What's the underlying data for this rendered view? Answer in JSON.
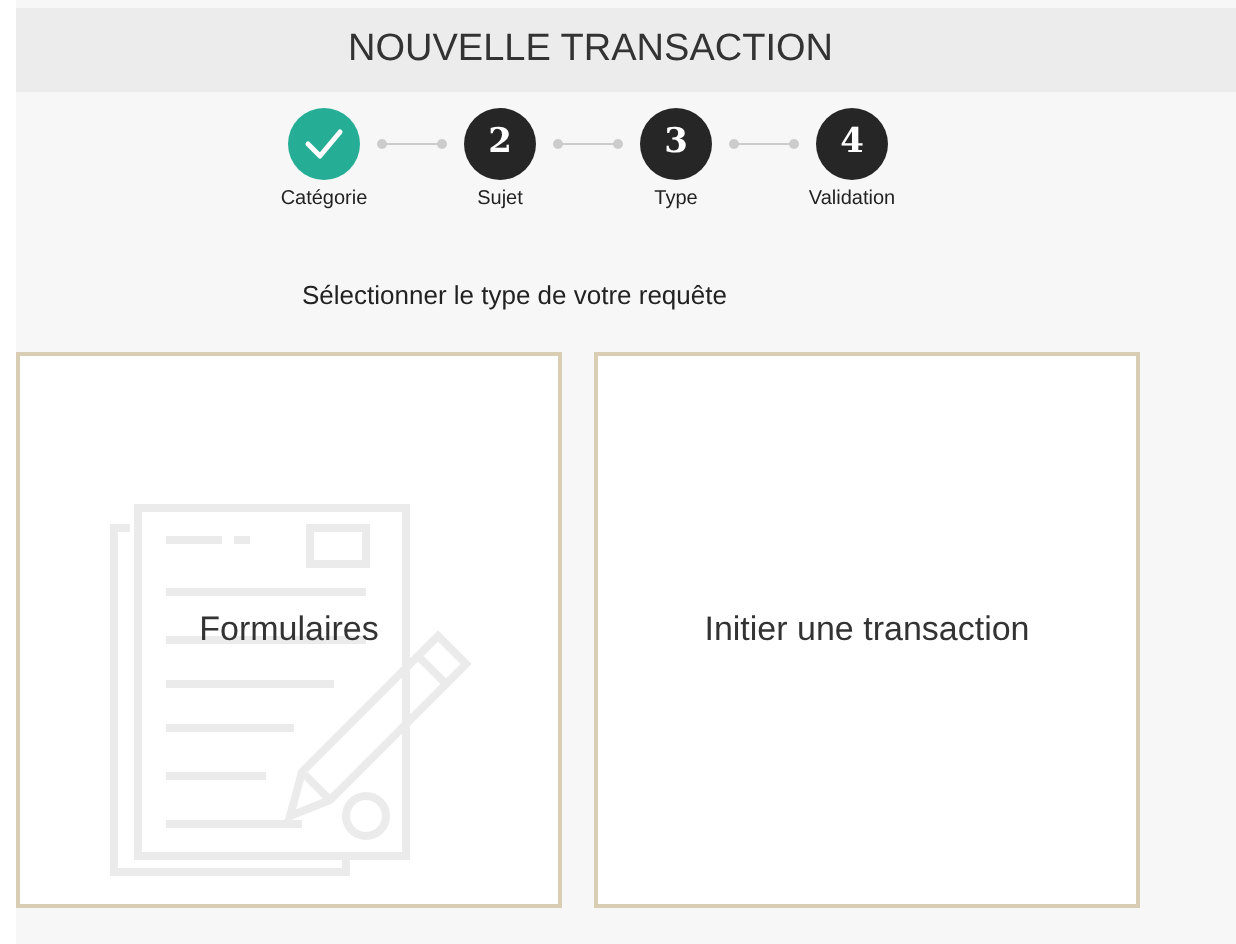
{
  "title": "NOUVELLE TRANSACTION",
  "steps": [
    {
      "label": "Catégorie",
      "done": true
    },
    {
      "label": "Sujet",
      "number": "2",
      "done": false
    },
    {
      "label": "Type",
      "number": "3",
      "done": false
    },
    {
      "label": "Validation",
      "number": "4",
      "done": false
    }
  ],
  "prompt": "Sélectionner le type de votre requête",
  "options": [
    {
      "label": "Formulaires",
      "kind": "form"
    },
    {
      "label": "Initier une transaction",
      "kind": "plain"
    }
  ]
}
